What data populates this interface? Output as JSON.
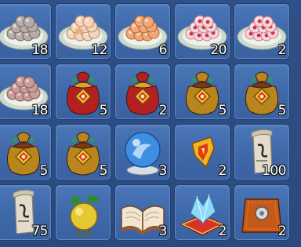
{
  "inventory": {
    "slots": [
      {
        "icon": "dumpling-plate-gray-icon",
        "quantity": "18"
      },
      {
        "icon": "dumpling-plate-peach-icon",
        "quantity": "12"
      },
      {
        "icon": "dumpling-plate-orange-icon",
        "quantity": "6"
      },
      {
        "icon": "flower-cake-plate-icon",
        "quantity": "20"
      },
      {
        "icon": "flower-cake-plate-icon",
        "quantity": "2"
      },
      {
        "icon": "dumpling-plate-pink-icon",
        "quantity": "18"
      },
      {
        "icon": "red-lucky-bag-icon",
        "quantity": "5"
      },
      {
        "icon": "red-lucky-bag-icon",
        "quantity": "2"
      },
      {
        "icon": "gold-lucky-bag-icon",
        "quantity": "5"
      },
      {
        "icon": "gold-lucky-bag-icon",
        "quantity": "5"
      },
      {
        "icon": "gold-lucky-bag-icon",
        "quantity": "5"
      },
      {
        "icon": "gold-lucky-bag-icon",
        "quantity": "5"
      },
      {
        "icon": "blue-crystal-orb-icon",
        "quantity": "3"
      },
      {
        "icon": "fire-rune-fragment-icon",
        "quantity": "2"
      },
      {
        "icon": "scroll-icon",
        "quantity": "100"
      },
      {
        "icon": "scroll-icon",
        "quantity": "75"
      },
      {
        "icon": "golden-fruit-icon",
        "quantity": ""
      },
      {
        "icon": "open-book-icon",
        "quantity": "3"
      },
      {
        "icon": "crystal-cushion-icon",
        "quantity": "2"
      },
      {
        "icon": "orange-pouch-icon",
        "quantity": "2"
      }
    ]
  }
}
